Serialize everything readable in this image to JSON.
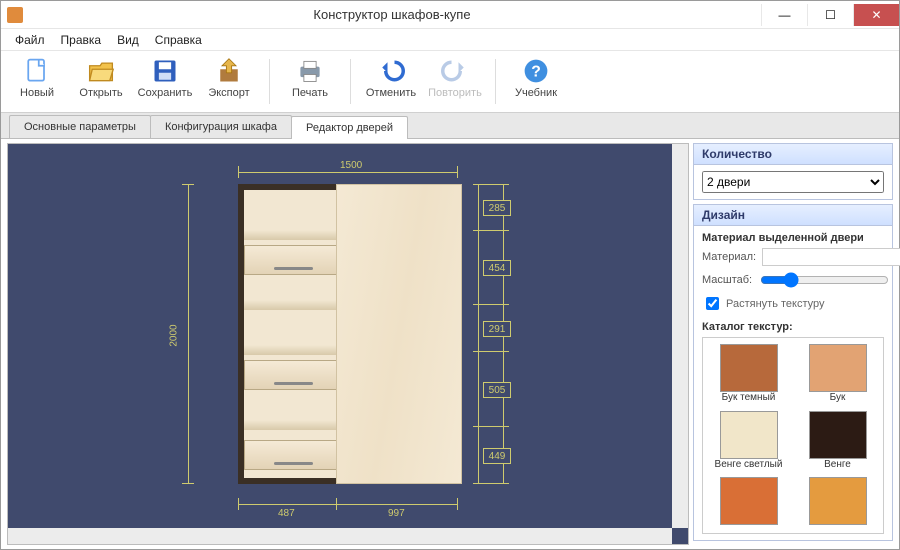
{
  "window": {
    "title": "Конструктор шкафов-купе"
  },
  "menu": {
    "file": "Файл",
    "edit": "Правка",
    "view": "Вид",
    "help": "Справка"
  },
  "toolbar": {
    "new": "Новый",
    "open": "Открыть",
    "save": "Сохранить",
    "export": "Экспорт",
    "print": "Печать",
    "undo": "Отменить",
    "redo": "Повторить",
    "tutorial": "Учебник"
  },
  "tabs": {
    "basic": "Основные параметры",
    "config": "Конфигурация шкафа",
    "doors": "Редактор дверей"
  },
  "drawing": {
    "total_width": "1500",
    "total_height": "2000",
    "bottom_left": "487",
    "bottom_right": "997",
    "segments": [
      "285",
      "454",
      "291",
      "505",
      "449"
    ]
  },
  "side": {
    "qty_header": "Количество",
    "qty_value": "2 двери",
    "design_header": "Дизайн",
    "mat_section": "Материал выделенной двери",
    "mat_label": "Материал:",
    "scale_label": "Масштаб:",
    "stretch": "Растянуть текстуру",
    "catalog": "Каталог текстур:",
    "textures": [
      {
        "name": "Бук темный",
        "color": "#b7693b"
      },
      {
        "name": "Бук",
        "color": "#e2a373"
      },
      {
        "name": "Венге светлый",
        "color": "#f1e6c9"
      },
      {
        "name": "Венге",
        "color": "#2c1b14"
      },
      {
        "name": "",
        "color": "#d96f36"
      },
      {
        "name": "",
        "color": "#e49b3f"
      }
    ]
  },
  "icons": {
    "close_glyph": "✕",
    "min_glyph": "—",
    "max_glyph": "☐"
  }
}
